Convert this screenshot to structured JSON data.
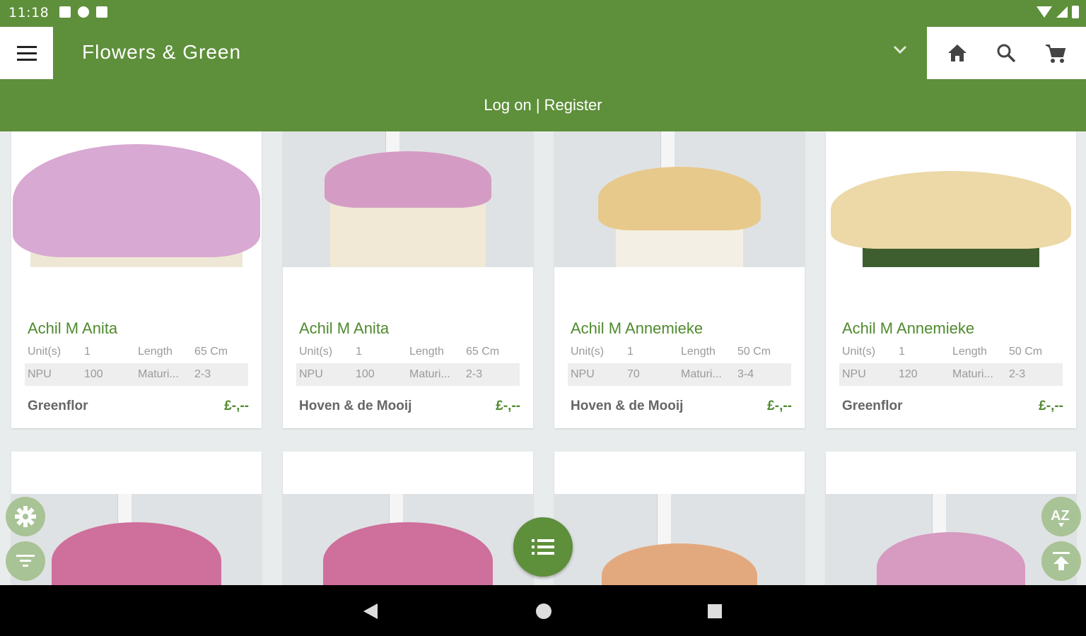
{
  "status_bar": {
    "time": "11:18"
  },
  "app_bar": {
    "title": "Flowers & Green",
    "login_text": "Log on | Register"
  },
  "specs_labels": {
    "units": "Unit(s)",
    "length": "Length",
    "npu": "NPU",
    "maturity": "Maturi..."
  },
  "products": [
    {
      "name": "Achil M Anita",
      "units": "1",
      "length": "65 Cm",
      "npu": "100",
      "maturity": "2-3",
      "vendor": "Greenflor",
      "price": "£-,--"
    },
    {
      "name": "Achil M Anita",
      "units": "1",
      "length": "65 Cm",
      "npu": "100",
      "maturity": "2-3",
      "vendor": "Hoven & de Mooij",
      "price": "£-,--"
    },
    {
      "name": "Achil M Annemieke",
      "units": "1",
      "length": "50 Cm",
      "npu": "70",
      "maturity": "3-4",
      "vendor": "Hoven & de Mooij",
      "price": "£-,--"
    },
    {
      "name": "Achil M Annemieke",
      "units": "1",
      "length": "50 Cm",
      "npu": "120",
      "maturity": "2-3",
      "vendor": "Greenflor",
      "price": "£-,--"
    }
  ],
  "icons": {
    "menu": "hamburger-icon",
    "dropdown": "chevron-down-icon",
    "home": "home-icon",
    "search": "search-icon",
    "cart": "cart-icon",
    "settings": "gear-icon",
    "filter": "filter-icon",
    "list": "list-icon",
    "sort": "sort-az-icon",
    "scroll_top": "arrow-up-icon"
  },
  "colors": {
    "brand": "#5e8f3a",
    "product_name": "#4f8a2e",
    "price": "#4f8a2e"
  }
}
